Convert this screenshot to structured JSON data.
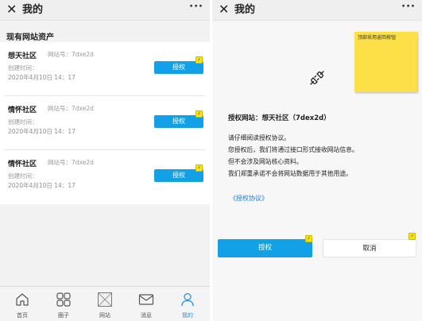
{
  "left": {
    "titlebar": {
      "close": "✕",
      "title": "我的",
      "more": "···"
    },
    "section_title": "现有网站资产",
    "sites": [
      {
        "name": "想天社区",
        "site_no": "网站号：7dxe2d",
        "created_label": "创建时间：",
        "created_time": "2020年4月10日  14：17",
        "button": "授权",
        "badge": "⚡"
      },
      {
        "name": "情怀社区",
        "site_no": "网站号：7dxe2d",
        "created_label": "创建时间：",
        "created_time": "2020年4月10日  14：17",
        "button": "授权",
        "badge": "⚡"
      },
      {
        "name": "情怀社区",
        "site_no": "网站号：7dxe2d",
        "created_label": "创建时间：",
        "created_time": "2020年4月10日  14：17",
        "button": "授权",
        "badge": "⚡"
      }
    ],
    "tabs": [
      {
        "label": "首页",
        "icon": "home-icon"
      },
      {
        "label": "圈子",
        "icon": "grid-icon"
      },
      {
        "label": "网站",
        "icon": "image-placeholder-icon"
      },
      {
        "label": "消息",
        "icon": "mail-icon"
      },
      {
        "label": "我的",
        "icon": "person-icon",
        "active": true
      }
    ],
    "active_color": "#2e90dd"
  },
  "right": {
    "titlebar": {
      "close": "✕",
      "title": "我的",
      "more": "···"
    },
    "sticky_note": "顶部采用返回按钮",
    "plug_icon": "plug-disconnected-icon",
    "auth_title": "授权网站：想天社区（7dex2d）",
    "paragraphs": [
      "请仔细阅读授权协议。",
      "您授权后，我们将通过接口形式接收网站信息。",
      "但不会涉及网站核心资料。",
      "我们郑重承诺不会将网站数据用于其他用途。"
    ],
    "agreement_link": "《授权协议》",
    "authorize_button": "授权",
    "cancel_button": "取消",
    "badge": "⚡"
  },
  "colors": {
    "accent": "#12a0e6",
    "sticky": "#fde047",
    "link": "#1e78d6"
  }
}
